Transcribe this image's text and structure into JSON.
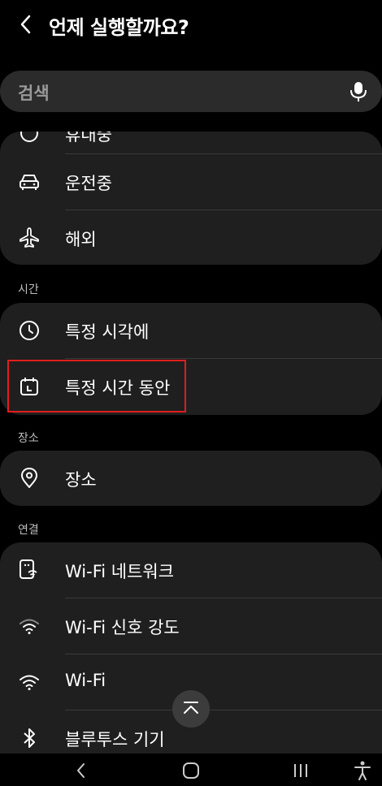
{
  "header": {
    "title": "언제 실행할까요?"
  },
  "search": {
    "placeholder": "검색"
  },
  "cards": {
    "top": {
      "partial_label": "휴대중",
      "driving": "운전중",
      "abroad": "해외"
    },
    "time": {
      "section": "시간",
      "at_time": "특정 시각에",
      "during_time": "특정 시간 동안"
    },
    "place": {
      "section": "장소",
      "place": "장소"
    },
    "connection": {
      "section": "연결",
      "wifi_network": "Wi-Fi 네트워크",
      "wifi_strength": "Wi-Fi 신호 강도",
      "wifi": "Wi-Fi",
      "bluetooth": "블루투스 기기"
    }
  },
  "icons": {
    "back": "chevron-left-icon",
    "mic": "mic-icon",
    "car": "car-icon",
    "plane": "plane-icon",
    "clock": "clock-icon",
    "calendar": "calendar-icon",
    "location": "location-pin-icon",
    "wifi_network": "wifi-network-icon",
    "wifi_strength": "wifi-strength-icon",
    "wifi": "wifi-icon",
    "bluetooth": "bluetooth-icon",
    "scroll_top": "scroll-to-top-icon"
  },
  "colors": {
    "highlight": "#e21d1d",
    "card": "#1f1f1f",
    "search": "#2b2b2b"
  }
}
